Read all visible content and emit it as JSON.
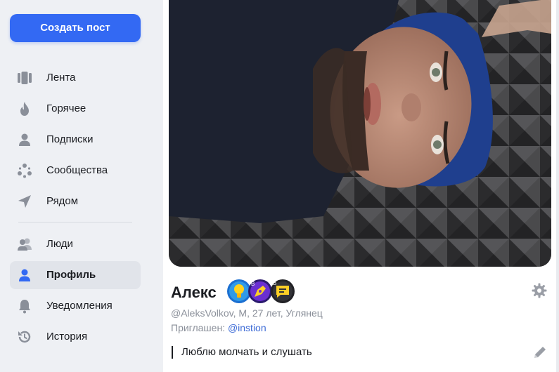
{
  "sidebar": {
    "create_button": "Создать пост",
    "items": [
      {
        "label": "Лента",
        "icon": "feed-icon"
      },
      {
        "label": "Горячее",
        "icon": "flame-icon"
      },
      {
        "label": "Подписки",
        "icon": "person-icon"
      },
      {
        "label": "Сообщества",
        "icon": "community-icon"
      },
      {
        "label": "Рядом",
        "icon": "location-arrow-icon"
      },
      {
        "label": "Люди",
        "icon": "people-icon"
      },
      {
        "label": "Профиль",
        "icon": "profile-icon",
        "active": true
      },
      {
        "label": "Уведомления",
        "icon": "bell-icon"
      },
      {
        "label": "История",
        "icon": "history-icon"
      }
    ]
  },
  "profile": {
    "name": "Алекс",
    "meta": "@AleksVolkov, М, 27 лет, Углянец",
    "invited_label": "Приглашен: ",
    "invited_by": "@instion",
    "bio": "Люблю молчать и слушать",
    "badges": [
      "lightbulb-badge-icon",
      "pen-badge-icon",
      "chat-badge-icon"
    ]
  },
  "colors": {
    "accent": "#3369f3",
    "link": "#3d6bd6",
    "muted_text": "#8a8f99",
    "sidebar_bg": "#eef0f4",
    "active_item_bg": "#e1e4ea",
    "icon_gray": "#8a8f99"
  }
}
